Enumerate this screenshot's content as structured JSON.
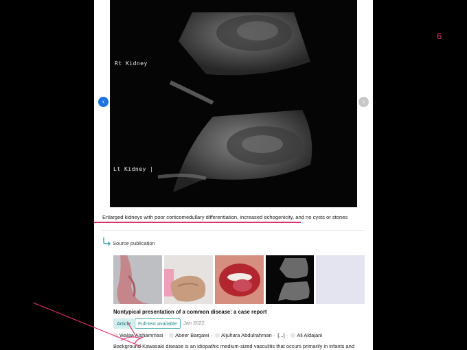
{
  "viewer": {
    "prev_label": "‹",
    "next_label": "›",
    "image": {
      "label_right": "Rt Kidney",
      "label_left": "Lt Kidney |"
    },
    "caption": "Enlarged kidneys with poor corticomedullary differentiation, increased echogenicity, and no cysts or stones"
  },
  "source": {
    "label": "Source publication",
    "icon": "return-arrow-icon"
  },
  "publication": {
    "title": "Nontypical presentation of a common disease: a case report",
    "type_badge": "Article",
    "fulltext_badge": "Full-text available",
    "date": "Jan 2022",
    "authors": [
      "Walaa Alshammasi",
      "Abeer Bargawi",
      "Aljuhara Abdulrahman",
      "[...]",
      "Ali Aldajani"
    ],
    "abstract": "Background Kawasaki disease is an idiopathic medium-sized vasculitis that occurs primarily in infants and"
  },
  "page_number": "6",
  "colors": {
    "highlight": "#e0306a",
    "accent_blue": "#1a73e8",
    "teal": "#1c8a8a"
  }
}
